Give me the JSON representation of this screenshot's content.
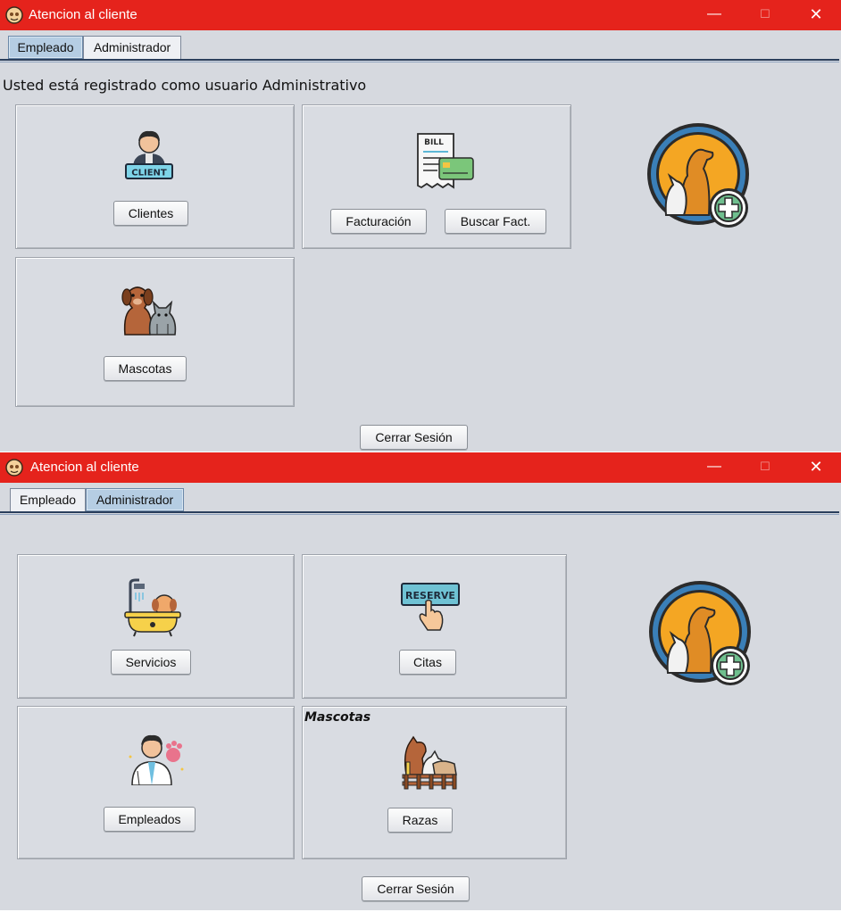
{
  "window1": {
    "title": "Atencion al cliente",
    "controls": {
      "minimize": "—",
      "maximize": "☐",
      "close": "✕"
    },
    "tabs": [
      {
        "label": "Empleado",
        "active": true
      },
      {
        "label": "Administrador",
        "active": false
      }
    ],
    "info_text": "Usted está registrado como usuario Administrativo",
    "panels": {
      "clientes": {
        "icon": "client-icon",
        "icon_text": "CLIENT",
        "button": "Clientes"
      },
      "facturacion": {
        "icon": "bill-icon",
        "icon_text": "BILL",
        "buttons": [
          "Facturación",
          "Buscar Fact."
        ]
      },
      "mascotas": {
        "icon": "pets-icon",
        "button": "Mascotas"
      }
    },
    "logo": "vet-logo-icon",
    "logout": "Cerrar Sesión"
  },
  "window2": {
    "title": "Atencion al cliente",
    "controls": {
      "minimize": "—",
      "maximize": "☐",
      "close": "✕"
    },
    "tabs": [
      {
        "label": "Empleado",
        "active": false
      },
      {
        "label": "Administrador",
        "active": true
      }
    ],
    "panels": {
      "servicios": {
        "icon": "pet-bath-icon",
        "button": "Servicios"
      },
      "citas": {
        "icon": "reserve-icon",
        "icon_text": "RESERVE",
        "button": "Citas"
      },
      "empleados": {
        "icon": "vet-employee-icon",
        "button": "Empleados"
      },
      "razas": {
        "title": "Mascotas",
        "icon": "breeds-icon",
        "button": "Razas"
      }
    },
    "logo": "vet-logo-icon",
    "logout": "Cerrar Sesión"
  },
  "colors": {
    "titlebar": "#e5231c",
    "background": "#d6d9df",
    "active_tab": "#b5cde3",
    "logo_orange": "#f4a623",
    "logo_ring": "#3a7fb8"
  }
}
